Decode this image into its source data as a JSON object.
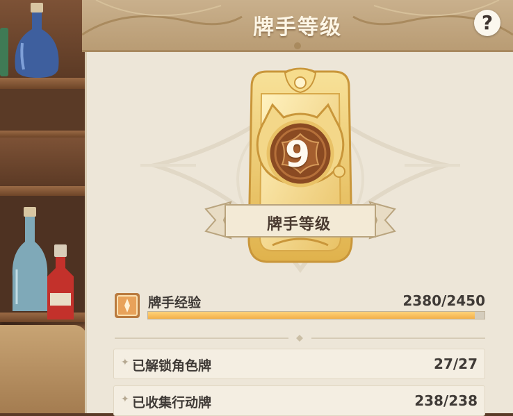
{
  "header": {
    "title": "牌手等级",
    "help_label": "?"
  },
  "badge": {
    "level": "9",
    "ribbon_label": "牌手等级"
  },
  "experience": {
    "label": "牌手经验",
    "current": 2380,
    "max": 2450,
    "value_text": "2380/2450",
    "progress": 0.9714
  },
  "stats": [
    {
      "label": "已解锁角色牌",
      "value": "27/27"
    },
    {
      "label": "已收集行动牌",
      "value": "238/238"
    }
  ],
  "colors": {
    "accent_gold": "#e8c25e",
    "progress_fill": "#f3b04a",
    "panel_bg": "#ede6d8",
    "text_dark": "#3f3a36"
  }
}
